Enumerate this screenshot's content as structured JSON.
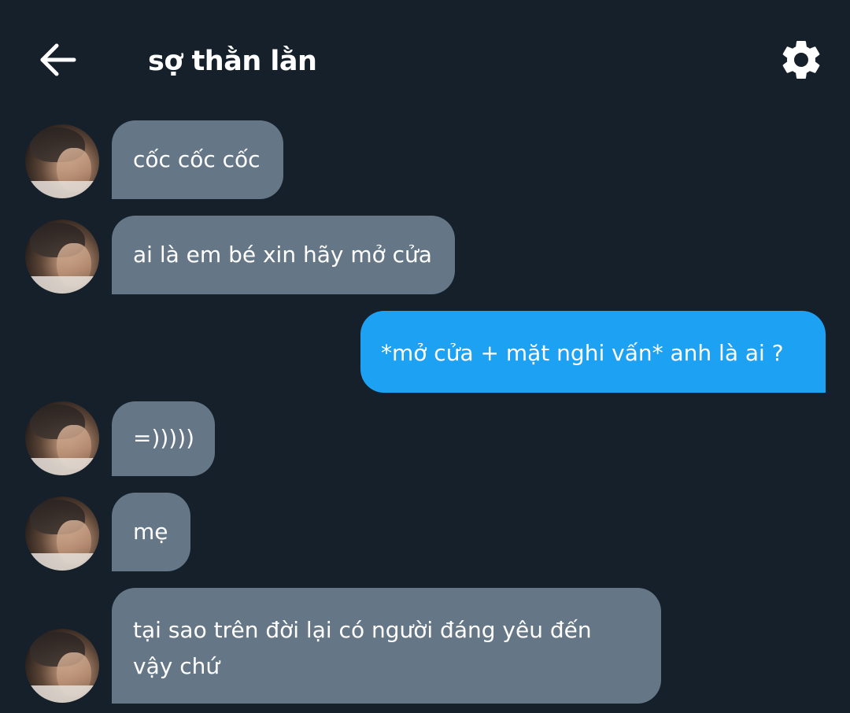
{
  "header": {
    "title": "sợ thằn lằn",
    "back_icon": "arrow-left-icon",
    "settings_icon": "gear-icon"
  },
  "colors": {
    "background": "#15202b",
    "received_bubble": "#657786",
    "sent_bubble": "#1da1f2",
    "text": "#ffffff"
  },
  "messages": [
    {
      "sender": "other",
      "text": "cốc cốc cốc"
    },
    {
      "sender": "other",
      "text": "ai là em bé xin hãy mở cửa"
    },
    {
      "sender": "me",
      "text": "*mở cửa + mặt nghi vấn* anh là ai ?"
    },
    {
      "sender": "other",
      "text": "=)))))"
    },
    {
      "sender": "other",
      "text": "mẹ"
    },
    {
      "sender": "other",
      "text": "tại sao trên đời lại có người đáng yêu đến vậy chứ"
    }
  ]
}
